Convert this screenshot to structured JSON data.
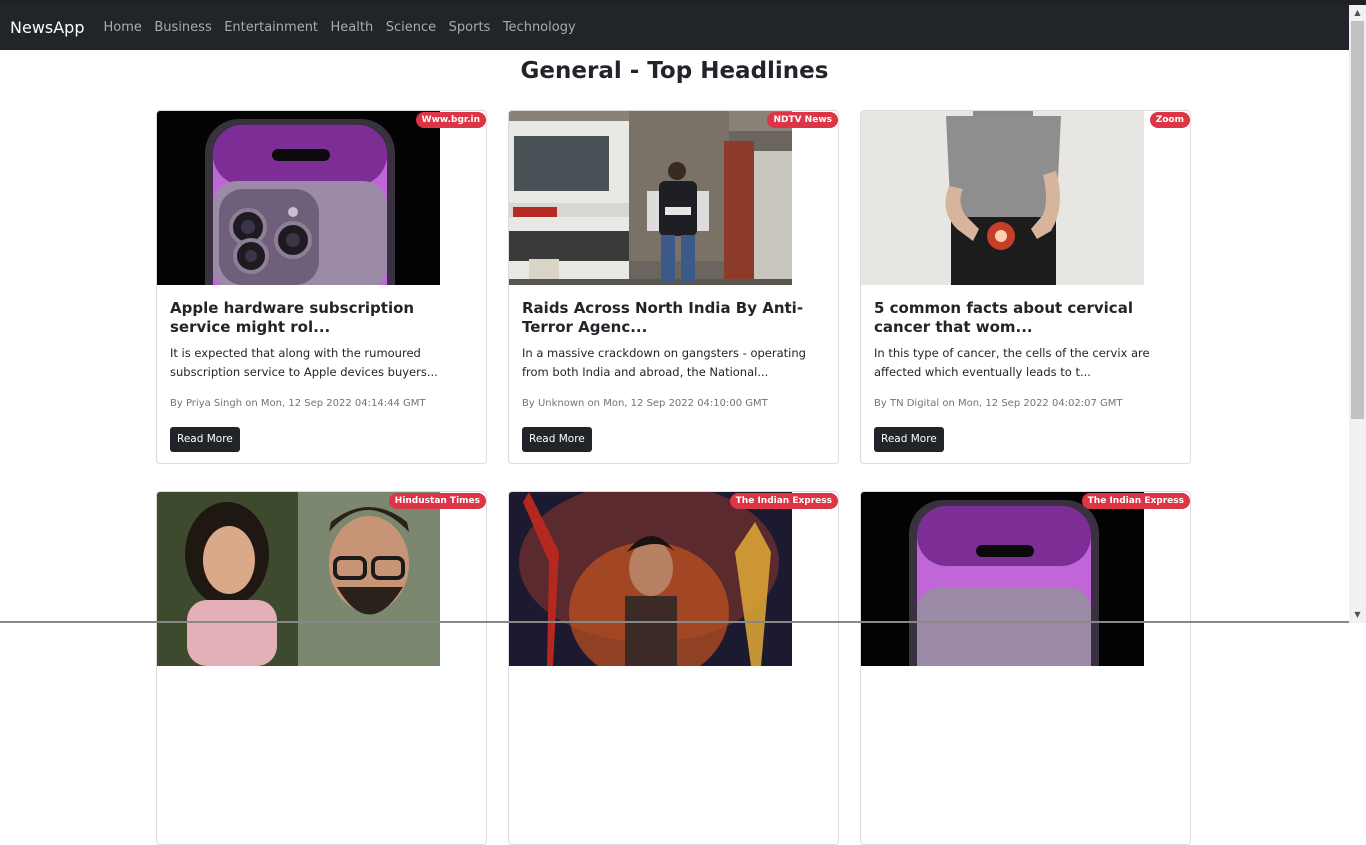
{
  "navbar": {
    "brand": "NewsApp",
    "links": [
      "Home",
      "Business",
      "Entertainment",
      "Health",
      "Science",
      "Sports",
      "Technology"
    ]
  },
  "page_title": "General - Top Headlines",
  "read_more_label": "Read More",
  "articles": [
    {
      "source": "Www.bgr.in",
      "title": "Apple hardware subscription service might rol...",
      "description": "It is expected that along with the rumoured subscription service to Apple devices buyers...",
      "meta": "By Priya Singh on Mon, 12 Sep 2022 04:14:44 GMT"
    },
    {
      "source": "NDTV News",
      "title": "Raids Across North India By Anti-Terror Agenc...",
      "description": "In a massive crackdown on gangsters - operating from both India and abroad, the National...",
      "meta": "By Unknown on Mon, 12 Sep 2022 04:10:00 GMT"
    },
    {
      "source": "Zoom",
      "title": "5 common facts about cervical cancer that wom...",
      "description": "In this type of cancer, the cells of the cervix are affected which eventually leads to t...",
      "meta": "By TN Digital on Mon, 12 Sep 2022 04:02:07 GMT"
    },
    {
      "source": "Hindustan Times"
    },
    {
      "source": "The Indian Express"
    },
    {
      "source": "The Indian Express"
    }
  ],
  "colors": {
    "navbar_bg": "#212529",
    "badge_bg": "#dc3545",
    "button_bg": "#212529"
  }
}
